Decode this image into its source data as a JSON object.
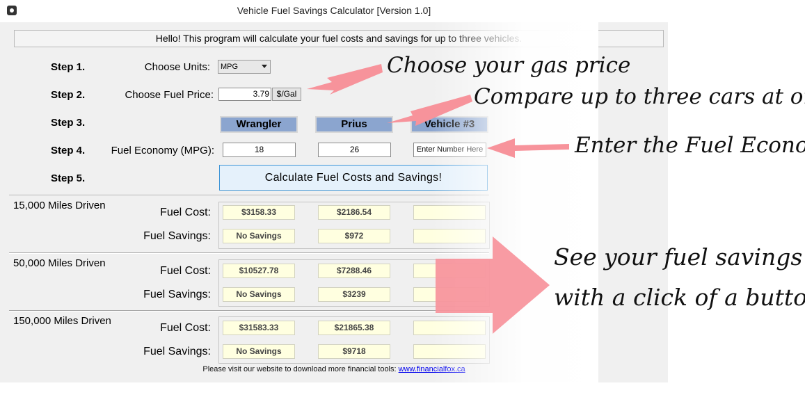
{
  "window": {
    "title": "Vehicle Fuel Savings Calculator  [Version 1.0]",
    "banner": "Hello! This program will calculate your fuel costs and savings for up to three vehicles."
  },
  "steps": {
    "step1": "Step 1.",
    "step2": "Step 2.",
    "step3": "Step 3.",
    "step4": "Step 4.",
    "step5": "Step 5."
  },
  "labels": {
    "units": "Choose Units:",
    "fuel_price": "Choose Fuel Price:",
    "fuel_economy": "Fuel Economy (MPG):"
  },
  "units_select": {
    "value": "MPG"
  },
  "fuel_price": {
    "value": "3.79",
    "unit": "$/Gal"
  },
  "vehicles": [
    {
      "name": "Wrangler",
      "mpg": "18"
    },
    {
      "name": "Prius",
      "mpg": "26"
    },
    {
      "name": "Vehicle #3",
      "mpg_placeholder": "Enter Number Here"
    }
  ],
  "calculate_button": "Calculate Fuel Costs and Savings!",
  "row_labels": {
    "cost": "Fuel Cost:",
    "savings": "Fuel Savings:"
  },
  "sections": [
    {
      "title": "15,000 Miles Driven",
      "costs": [
        "$3158.33",
        "$2186.54",
        ""
      ],
      "savings": [
        "No Savings",
        "$972",
        ""
      ]
    },
    {
      "title": "50,000 Miles Driven",
      "costs": [
        "$10527.78",
        "$7288.46",
        ""
      ],
      "savings": [
        "No Savings",
        "$3239",
        ""
      ]
    },
    {
      "title": "150,000 Miles Driven",
      "costs": [
        "$31583.33",
        "$21865.38",
        ""
      ],
      "savings": [
        "No Savings",
        "$9718",
        ""
      ]
    }
  ],
  "footer": {
    "text": "Please visit our website to download more financial tools: ",
    "link": "www.financialfox.ca"
  },
  "annotations": {
    "gas_price": "Choose your gas price",
    "compare": "Compare up to three cars at once",
    "economy": "Enter the Fuel Economy",
    "savings_line1": "See your fuel savings",
    "savings_line2": "with a click of a button."
  },
  "colors": {
    "arrow": "#f7939b",
    "vehicle_header": "#8ba5cf",
    "result_bg": "#ffffe0",
    "button_border": "#3c94d6"
  }
}
